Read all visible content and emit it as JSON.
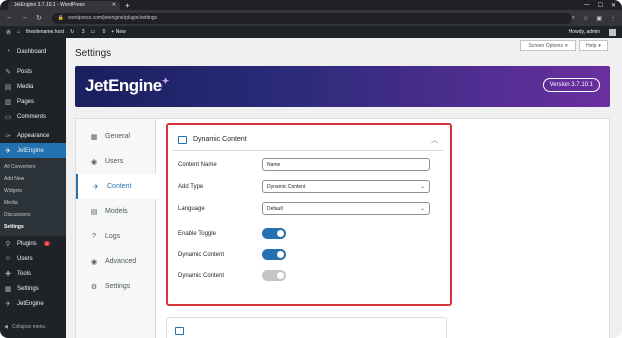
{
  "browser": {
    "tab_title": "JetEngine 3.7.10.1 - WordPress",
    "url": "wordpress.com/jetengine/plugin/settings"
  },
  "admin_bar": {
    "site": "thesitename.host",
    "updates": "3",
    "comments": "0",
    "new": "+ New",
    "howdy": "Howdy, admin"
  },
  "sidebar": {
    "items": [
      {
        "label": "Dashboard",
        "icon": "dashboard-icon"
      },
      {
        "label": "Posts",
        "icon": "pin-icon"
      },
      {
        "label": "Media",
        "icon": "media-icon"
      },
      {
        "label": "Pages",
        "icon": "page-icon"
      },
      {
        "label": "Comments",
        "icon": "comment-icon"
      },
      {
        "label": "Appearance",
        "icon": "brush-icon"
      },
      {
        "label": "JetEngine",
        "icon": "jetengine-icon"
      }
    ],
    "submenu": [
      "All Converters",
      "Add New",
      "Widgets",
      "Media",
      "Discussions",
      "Settings"
    ],
    "items2": [
      {
        "label": "Plugins",
        "icon": "plugin-icon",
        "badge": "1"
      },
      {
        "label": "Users",
        "icon": "user-icon"
      },
      {
        "label": "Tools",
        "icon": "wrench-icon"
      },
      {
        "label": "Settings",
        "icon": "settings-icon"
      },
      {
        "label": "JetEngine",
        "icon": "jetengine-icon"
      }
    ],
    "collapse": "Collapse menu"
  },
  "page": {
    "title": "Settings",
    "screen_options": "Screen Options",
    "help": "Help"
  },
  "banner": {
    "logo": "JetEngine",
    "version": "Version 3.7.10.1"
  },
  "settings_nav": [
    {
      "label": "General",
      "icon": "grid-icon"
    },
    {
      "label": "Users",
      "icon": "globe-icon"
    },
    {
      "label": "Content",
      "icon": "jetengine-icon"
    },
    {
      "label": "Models",
      "icon": "table-icon"
    },
    {
      "label": "Logs",
      "icon": "question-icon"
    },
    {
      "label": "Advanced",
      "icon": "globe-icon"
    },
    {
      "label": "Settings",
      "icon": "gear-icon"
    }
  ],
  "card": {
    "title": "Dynamic Content",
    "fields": {
      "content_name": {
        "label": "Content Name",
        "value": "Name"
      },
      "add_type": {
        "label": "Add Type",
        "value": "Dynamic Content"
      },
      "language": {
        "label": "Language",
        "value": "Default"
      }
    },
    "toggles": [
      {
        "label": "Enable Toggle",
        "on": true
      },
      {
        "label": "Dynamic Content",
        "on": true
      },
      {
        "label": "Dynamic Content",
        "on": false
      }
    ]
  },
  "colors": {
    "accent": "#2271b1",
    "highlight": "#d63638"
  }
}
